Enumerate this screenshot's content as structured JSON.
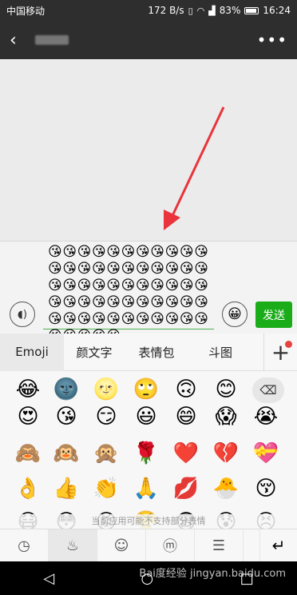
{
  "status": {
    "carrier": "中国移动",
    "speed": "172 B/s",
    "battery": "83%",
    "time": "16:24"
  },
  "header": {
    "back_icon": "chevron-left-icon",
    "more_icon": "more-icon"
  },
  "composer": {
    "text": "😘😘😘😘😘😘😘😘😘😘😘😘😘😘😘😘😘😘😘😘😘😘😘😘😘😘😘😘😘😘😘😘😘😘😘😘😘😘😘😘😘😘😘😘😘😘😘😘😘😘😘😘😘😘😘😘😘😘😘😘",
    "send_label": "发送",
    "accent": "#1aad19"
  },
  "tabs": [
    {
      "label": "Emoji"
    },
    {
      "label": "颜文字"
    },
    {
      "label": "表情包"
    },
    {
      "label": "斗图"
    }
  ],
  "emoji_grid": [
    [
      "😂",
      "🌚",
      "🌝",
      "🙄",
      "🙃",
      "😊"
    ],
    [
      "😍",
      "😘",
      "😏",
      "😃",
      "😄",
      "😱",
      "😭"
    ],
    [
      "🙈",
      "🙉",
      "🙊",
      "🌹",
      "❤️",
      "💔",
      "💝"
    ],
    [
      "👌",
      "👍",
      "👏",
      "🙏",
      "💋",
      "🐣",
      "😚"
    ],
    [
      "😷",
      "😳",
      "😡",
      "😤",
      "😨",
      "😰",
      "😣"
    ]
  ],
  "keyboard_tip": "当前应用可能不支持部分表情",
  "categories": [
    "clock-icon",
    "fire-icon",
    "face-icon",
    "monkey-icon",
    "burger-icon"
  ],
  "watermark": "Bai度经验 jingyan.baidu.com"
}
